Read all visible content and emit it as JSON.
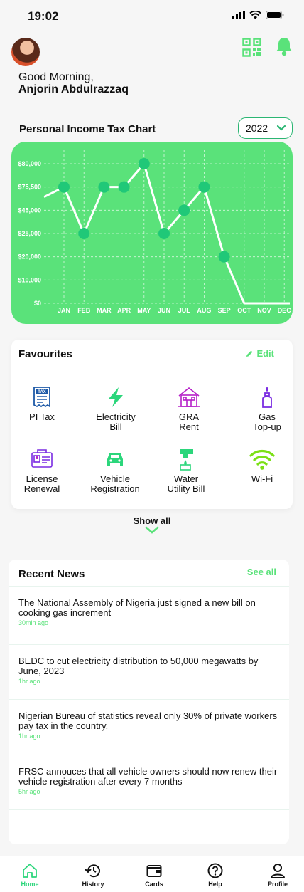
{
  "status": {
    "time": "19:02"
  },
  "header": {
    "greeting": "Good Morning,",
    "user_name": "Anjorin Abdulrazzaq"
  },
  "chart_section": {
    "title": "Personal Income Tax Chart",
    "year": "2022"
  },
  "chart_data": {
    "type": "line",
    "title": "Personal Income Tax Chart",
    "categories": [
      "JAN",
      "FEB",
      "MAR",
      "APR",
      "MAY",
      "JUN",
      "JUL",
      "AUG",
      "SEP",
      "OCT",
      "NOV",
      "DEC"
    ],
    "y_tick_labels": [
      "$0",
      "$10,000",
      "$20,000",
      "$25,000",
      "$45,000",
      "$75,500",
      "$80,000"
    ],
    "series": [
      {
        "values": [
          75500,
          25000,
          75500,
          75500,
          80000,
          25000,
          45000,
          75500,
          20000,
          0,
          0,
          0
        ]
      }
    ],
    "points_marked": [
      "JAN",
      "FEB",
      "MAR",
      "APR",
      "MAY",
      "JUN",
      "JUL",
      "AUG",
      "SEP"
    ],
    "grid": true,
    "colors": {
      "background": "#5ae27a",
      "line": "#ffffff",
      "points": "#20c878"
    }
  },
  "favourites": {
    "title": "Favourites",
    "edit_label": "Edit",
    "items": [
      {
        "label_line1": "PI Tax",
        "label_line2": "",
        "icon": "tax-document-icon"
      },
      {
        "label_line1": "Electricity",
        "label_line2": "Bill",
        "icon": "lightning-icon"
      },
      {
        "label_line1": "GRA",
        "label_line2": "Rent",
        "icon": "house-icon"
      },
      {
        "label_line1": "Gas",
        "label_line2": "Top-up",
        "icon": "gas-cylinder-icon"
      },
      {
        "label_line1": "License",
        "label_line2": "Renewal",
        "icon": "license-card-icon"
      },
      {
        "label_line1": "Vehicle",
        "label_line2": "Registration",
        "icon": "car-icon"
      },
      {
        "label_line1": "Water",
        "label_line2": "Utility Bill",
        "icon": "water-tap-icon"
      },
      {
        "label_line1": "Wi-Fi",
        "label_line2": "",
        "icon": "wifi-icon"
      }
    ],
    "show_all_label": "Show all"
  },
  "news": {
    "title": "Recent News",
    "see_all_label": "See all",
    "items": [
      {
        "text": "The National Assembly of Nigeria just signed a new bill on cooking gas increment",
        "age": "30min ago"
      },
      {
        "text": "BEDC to cut electricity distribution to 50,000 megawatts by June, 2023",
        "age": "1hr ago"
      },
      {
        "text": "Nigerian Bureau of statistics reveal only 30% of private workers pay tax in the country.",
        "age": "1hr ago"
      },
      {
        "text": "FRSC annouces that all vehicle owners should now renew their vehicle registration after every 7 months",
        "age": "5hr ago"
      }
    ]
  },
  "tabbar": {
    "items": [
      {
        "label": "Home",
        "icon": "home-icon",
        "active": true
      },
      {
        "label": "History",
        "icon": "history-icon"
      },
      {
        "label": "Cards",
        "icon": "wallet-icon"
      },
      {
        "label": "Help",
        "icon": "help-icon"
      },
      {
        "label": "Profile",
        "icon": "profile-icon"
      }
    ]
  }
}
